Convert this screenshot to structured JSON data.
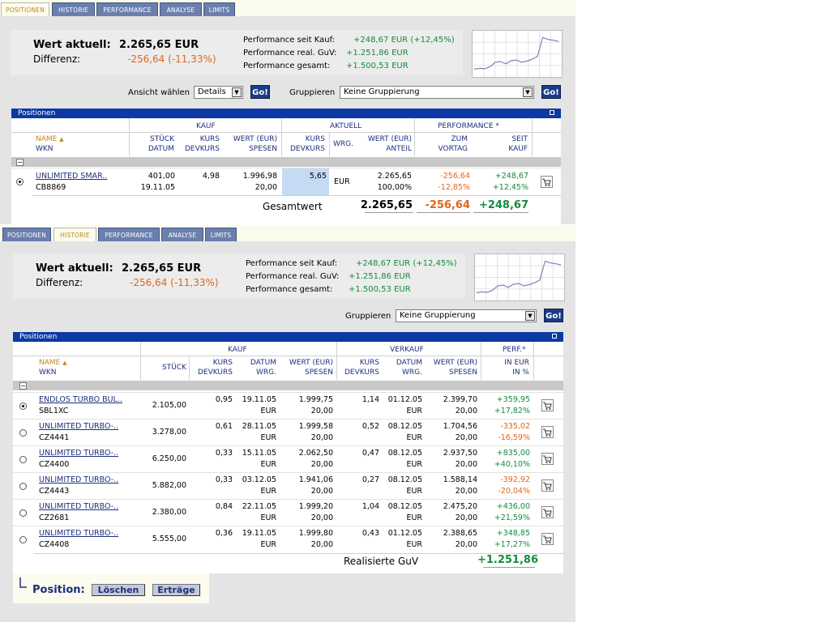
{
  "tabs": [
    "POSITIONEN",
    "HISTORIE",
    "PERFORMANCE",
    "ANALYSE",
    "LIMITS"
  ],
  "summary": {
    "wert_label": "Wert aktuell:",
    "wert_value": "2.265,65 EUR",
    "diff_label": "Differenz:",
    "diff_value": "-256,64 (-11,33%)",
    "perf_seit_kauf_label": "Performance seit Kauf:",
    "perf_seit_kauf_value": "+248,67 EUR (+12,45%)",
    "perf_real_label": "Performance real. GuV:",
    "perf_real_value": "+1.251,86 EUR",
    "perf_gesamt_label": "Performance gesamt:",
    "perf_gesamt_value": "+1.500,53 EUR"
  },
  "sparkline": [
    0.12,
    0.14,
    0.13,
    0.18,
    0.3,
    0.32,
    0.26,
    0.34,
    0.36,
    0.3,
    0.33,
    0.38,
    0.45,
    0.95,
    0.9,
    0.88,
    0.85
  ],
  "controls": {
    "ansicht_label": "Ansicht wählen",
    "ansicht_value": "Details",
    "go_label": "Go!",
    "gruppieren_label": "Gruppieren",
    "gruppieren_value": "Keine Gruppierung"
  },
  "panel1": {
    "title": "Positionen",
    "groups": {
      "kauf": "KAUF",
      "aktuell": "AKTUELL",
      "performance": "PERFORMANCE *"
    },
    "headers": {
      "name": "NAME",
      "wkn": "WKN",
      "stueck": "STÜCK",
      "datum": "DATUM",
      "kurs": "KURS",
      "devkurs": "DEVKURS",
      "wert": "WERT (EUR)",
      "spesen": "SPESEN",
      "akt_kurs": "KURS",
      "akt_devkurs": "DEVKURS",
      "wrg": "WRG.",
      "akt_wert": "WERT (EUR)",
      "anteil": "ANTEIL",
      "zum": "ZUM",
      "vortag": "VORTAG",
      "seit": "SEIT",
      "kauf": "KAUF"
    },
    "row": {
      "name": "UNLIMITED SMAR..",
      "wkn": "CB8869",
      "stueck": "401,00",
      "datum": "19.11.05",
      "kurs": "4,98",
      "wert": "1.996,98",
      "spesen": "20,00",
      "akt_kurs": "5,65",
      "wrg": "EUR",
      "akt_wert": "2.265,65",
      "anteil": "100,00%",
      "vortag_abs": "-256,64",
      "vortag_pct": "-12,85%",
      "seit_abs": "+248,67",
      "seit_pct": "+12,45%"
    },
    "total": {
      "label": "Gesamtwert",
      "wert": "2.265,65",
      "vortag": "-256,64",
      "seit": "+248,67"
    }
  },
  "panel2": {
    "title": "Positionen",
    "groups": {
      "kauf": "KAUF",
      "verkauf": "VERKAUF",
      "perf": "PERF.*"
    },
    "headers": {
      "name": "NAME",
      "wkn": "WKN",
      "stueck": "STÜCK",
      "kurs": "KURS",
      "devkurs": "DEVKURS",
      "datum": "DATUM",
      "wrg": "WRG.",
      "wert": "WERT (EUR)",
      "spesen": "SPESEN",
      "vk_kurs": "KURS",
      "vk_devkurs": "DEVKURS",
      "vk_datum": "DATUM",
      "vk_wrg": "WRG.",
      "vk_wert": "WERT (EUR)",
      "vk_spesen": "SPESEN",
      "in_eur": "IN EUR",
      "in_pct": "IN %"
    },
    "rows": [
      {
        "name": "ENDLOS TURBO BUL..",
        "wkn": "SBL1XC",
        "stueck": "2.105,00",
        "kurs": "0,95",
        "datum": "19.11.05",
        "wrg": "EUR",
        "wert": "1.999,75",
        "spesen": "20,00",
        "vk_kurs": "1,14",
        "vk_datum": "01.12.05",
        "vk_wrg": "EUR",
        "vk_wert": "2.399,70",
        "vk_spesen": "20,00",
        "perf_eur": "+359,95",
        "perf_pct": "+17,82%",
        "selected": true
      },
      {
        "name": "UNLIMITED TURBO-..",
        "wkn": "CZ4441",
        "stueck": "3.278,00",
        "kurs": "0,61",
        "datum": "28.11.05",
        "wrg": "EUR",
        "wert": "1.999,58",
        "spesen": "20,00",
        "vk_kurs": "0,52",
        "vk_datum": "08.12.05",
        "vk_wrg": "EUR",
        "vk_wert": "1.704,56",
        "vk_spesen": "20,00",
        "perf_eur": "-335,02",
        "perf_pct": "-16,59%",
        "selected": false
      },
      {
        "name": "UNLIMITED TURBO-..",
        "wkn": "CZ4400",
        "stueck": "6.250,00",
        "kurs": "0,33",
        "datum": "15.11.05",
        "wrg": "EUR",
        "wert": "2.062,50",
        "spesen": "20,00",
        "vk_kurs": "0,47",
        "vk_datum": "08.12.05",
        "vk_wrg": "EUR",
        "vk_wert": "2.937,50",
        "vk_spesen": "20,00",
        "perf_eur": "+835,00",
        "perf_pct": "+40,10%",
        "selected": false
      },
      {
        "name": "UNLIMITED TURBO-..",
        "wkn": "CZ4443",
        "stueck": "5.882,00",
        "kurs": "0,33",
        "datum": "03.12.05",
        "wrg": "EUR",
        "wert": "1.941,06",
        "spesen": "20,00",
        "vk_kurs": "0,27",
        "vk_datum": "08.12.05",
        "vk_wrg": "EUR",
        "vk_wert": "1.588,14",
        "vk_spesen": "20,00",
        "perf_eur": "-392,92",
        "perf_pct": "-20,04%",
        "selected": false
      },
      {
        "name": "UNLIMITED TURBO-..",
        "wkn": "CZ2681",
        "stueck": "2.380,00",
        "kurs": "0,84",
        "datum": "22.11.05",
        "wrg": "EUR",
        "wert": "1.999,20",
        "spesen": "20,00",
        "vk_kurs": "1,04",
        "vk_datum": "08.12.05",
        "vk_wrg": "EUR",
        "vk_wert": "2.475,20",
        "vk_spesen": "20,00",
        "perf_eur": "+436,00",
        "perf_pct": "+21,59%",
        "selected": false
      },
      {
        "name": "UNLIMITED TURBO-..",
        "wkn": "CZ4408",
        "stueck": "5.555,00",
        "kurs": "0,36",
        "datum": "19.11.05",
        "wrg": "EUR",
        "wert": "1.999,80",
        "spesen": "20,00",
        "vk_kurs": "0,43",
        "vk_datum": "01.12.05",
        "vk_wrg": "EUR",
        "vk_wert": "2.388,65",
        "vk_spesen": "20,00",
        "perf_eur": "+348,85",
        "perf_pct": "+17,27%",
        "selected": false
      }
    ],
    "total": {
      "label": "Realisierte GuV",
      "value": "+1.251,86"
    },
    "position_bar": {
      "label": "Position:",
      "loeschen": "Löschen",
      "ertraege": "Erträge"
    }
  },
  "colors": {
    "blue": "#0d39a5",
    "navy": "#1c2f7c",
    "green": "#138c3c",
    "orange": "#e0661a",
    "gold": "#c08a1a"
  }
}
